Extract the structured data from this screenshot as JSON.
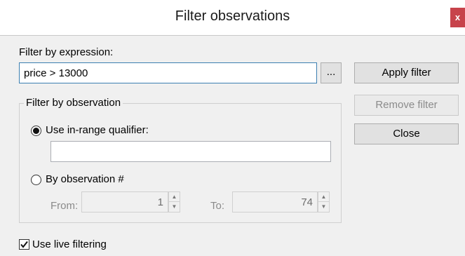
{
  "window": {
    "title": "Filter observations",
    "close_glyph": "x"
  },
  "expression": {
    "label": "Filter by expression:",
    "value": "price > 13000",
    "browse_label": "..."
  },
  "buttons": {
    "apply": "Apply filter",
    "remove": "Remove filter",
    "close": "Close"
  },
  "observation_group": {
    "legend": "Filter by observation",
    "inrange_label": "Use in-range qualifier:",
    "inrange_value": "",
    "byobs_label": "By observation #",
    "from_label": "From:",
    "from_value": "1",
    "to_label": "To:",
    "to_value": "74"
  },
  "live_filtering": {
    "label": "Use live filtering",
    "checked": true
  },
  "icons": {
    "check": "checkmark-icon",
    "spin_up": "up-arrow-icon",
    "spin_down": "down-arrow-icon"
  },
  "colors": {
    "close_button": "#c7434b",
    "focus_border": "#3c7fb1"
  }
}
